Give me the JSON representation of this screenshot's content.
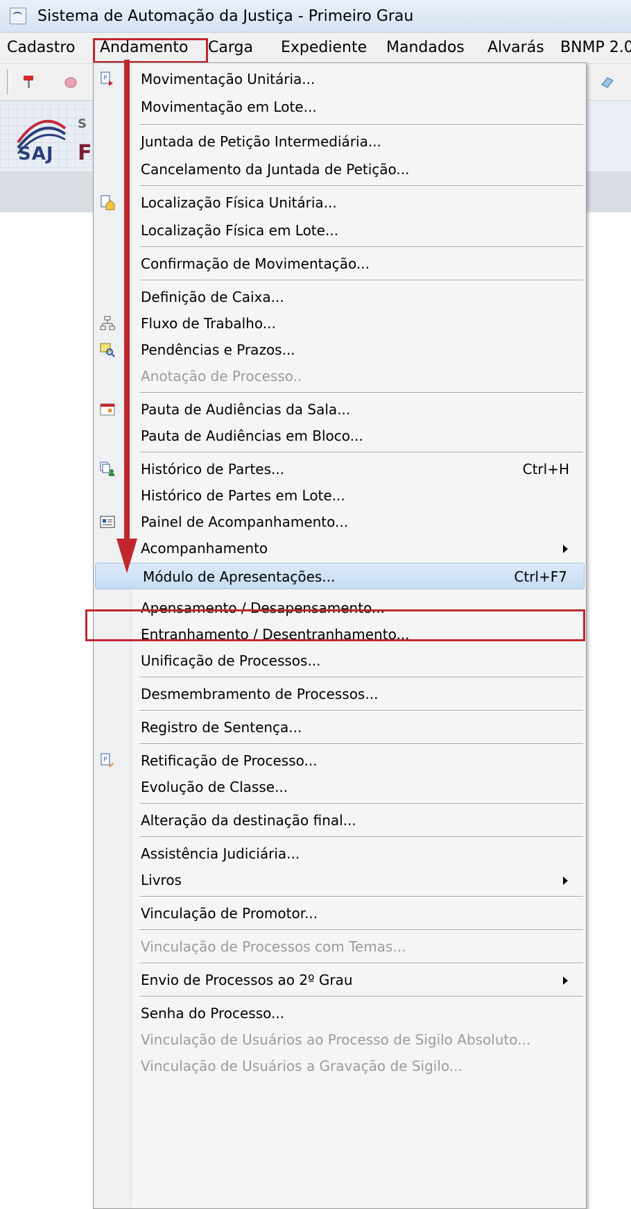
{
  "window": {
    "title": "Sistema de Automação da Justiça - Primeiro Grau"
  },
  "menubar": {
    "items": [
      "Cadastro",
      "Andamento",
      "Carga",
      "Expediente",
      "Mandados",
      "Alvarás",
      "BNMP 2.0"
    ]
  },
  "logo": {
    "text": "SAJ",
    "letter_f": "F",
    "letter_s": "S"
  },
  "menu": {
    "items": [
      {
        "label": "Movimentação Unitária...",
        "icon": "document-move-icon"
      },
      {
        "label": "Movimentação em Lote..."
      },
      {
        "label": "Juntada de Petição Intermediária..."
      },
      {
        "label": "Cancelamento da Juntada de Petição..."
      },
      {
        "label": "Localização Física Unitária...",
        "icon": "document-house-icon"
      },
      {
        "label": "Localização Física em Lote..."
      },
      {
        "label": "Confirmação de Movimentação..."
      },
      {
        "label": "Definição de Caixa..."
      },
      {
        "label": "Fluxo de Trabalho...",
        "icon": "workflow-icon"
      },
      {
        "label": "Pendências e Prazos...",
        "icon": "search-document-icon"
      },
      {
        "label": "Anotação de Processo..",
        "disabled": true
      },
      {
        "label": "Pauta de Audiências da Sala...",
        "icon": "calendar-icon"
      },
      {
        "label": "Pauta de Audiências em Bloco..."
      },
      {
        "label": "Histórico de Partes...",
        "shortcut": "Ctrl+H",
        "icon": "parties-history-icon"
      },
      {
        "label": "Histórico de Partes em Lote..."
      },
      {
        "label": "Painel de Acompanhamento...",
        "icon": "panel-icon"
      },
      {
        "label": "Acompanhamento",
        "submenu": true
      },
      {
        "label": "Módulo de Apresentações...",
        "shortcut": "Ctrl+F7",
        "selected": true
      },
      {
        "label": "Apensamento / Desapensamento..."
      },
      {
        "label": "Entranhamento / Desentranhamento..."
      },
      {
        "label": "Unificação de Processos..."
      },
      {
        "label": "Desmembramento de Processos..."
      },
      {
        "label": "Registro de Sentença..."
      },
      {
        "label": "Retificação de Processo...",
        "icon": "rectify-icon"
      },
      {
        "label": "Evolução de Classe..."
      },
      {
        "label": "Alteração da destinação final..."
      },
      {
        "label": "Assistência Judiciária..."
      },
      {
        "label": "Livros",
        "submenu": true
      },
      {
        "label": "Vinculação de Promotor..."
      },
      {
        "label": "Vinculação de Processos com Temas...",
        "disabled": true
      },
      {
        "label": "Envio de Processos ao 2º Grau",
        "submenu": true
      },
      {
        "label": "Senha do Processo..."
      },
      {
        "label": "Vinculação de Usuários ao Processo de Sigilo Absoluto...",
        "disabled": true
      },
      {
        "label": "Vinculação de Usuários a Gravação de Sigilo...",
        "disabled": true
      }
    ]
  },
  "colors": {
    "highlight_red": "#c0272d",
    "selected_bg": "#c7dcf3",
    "disabled_text": "#9b9b9b"
  }
}
